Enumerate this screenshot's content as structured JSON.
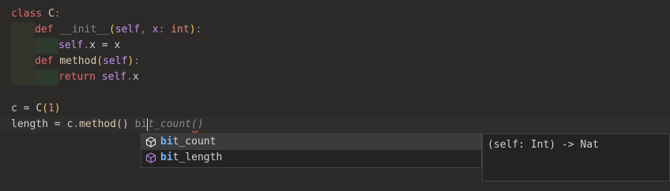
{
  "code": {
    "l1": {
      "kw": "class",
      "name": "C",
      "colon": ":"
    },
    "l2": {
      "kw": "def",
      "name": "__init__",
      "open": "(",
      "self": "self",
      "comma": ",",
      "param": "x",
      "colon1": ":",
      "type": "int",
      "close": ")",
      "colon2": ":"
    },
    "l3": {
      "self": "self",
      "dot": ".",
      "attr": "x",
      "eq": "=",
      "val": "x"
    },
    "l4": {
      "kw": "def",
      "name": "method",
      "open": "(",
      "self": "self",
      "close": ")",
      "colon": ":"
    },
    "l5": {
      "kw": "return",
      "self": "self",
      "dot": ".",
      "attr": "x"
    },
    "l7": {
      "var": "c",
      "eq": "=",
      "cls": "C",
      "open": "(",
      "num": "1",
      "close": ")"
    },
    "l8": {
      "var": "length",
      "eq": "=",
      "obj": "c",
      "dot": ".",
      "method": "method",
      "parens": "()",
      "typed": "bi",
      "ghost": "t_count()"
    }
  },
  "suggest": {
    "items": [
      {
        "match": "bi",
        "rest": "t_count",
        "icon": "cube-icon"
      },
      {
        "match": "bi",
        "rest": "t_length",
        "icon": "cube-icon"
      }
    ]
  },
  "details": {
    "signature": "(self: Int) -> Nat"
  },
  "colors": {
    "accent": "#6fb3ff",
    "icon": "#b180d7"
  }
}
